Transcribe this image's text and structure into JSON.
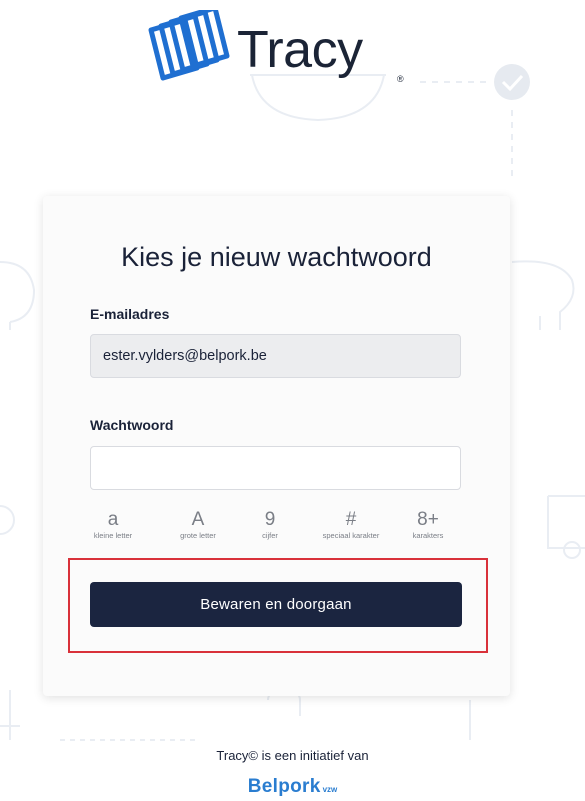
{
  "brand": {
    "logo_text": "Tracy",
    "logo_reg": "®"
  },
  "form": {
    "title": "Kies je nieuw wachtwoord",
    "email_label": "E-mailadres",
    "email_value": "ester.vylders@belpork.be",
    "password_label": "Wachtwoord",
    "password_value": "",
    "submit_label": "Bewaren en doorgaan"
  },
  "password_rules": [
    {
      "symbol": "a",
      "caption": "kleine letter"
    },
    {
      "symbol": "A",
      "caption": "grote letter"
    },
    {
      "symbol": "9",
      "caption": "cijfer"
    },
    {
      "symbol": "#",
      "caption": "speciaal karakter"
    },
    {
      "symbol": "8+",
      "caption": "karakters"
    }
  ],
  "footer": {
    "text": "Tracy© is een initiatief van",
    "org_name": "Belpork",
    "org_suffix": "vzw"
  },
  "colors": {
    "primary": "#1b2540",
    "highlight": "#d9313a",
    "brand_blue": "#2a7dd0"
  }
}
